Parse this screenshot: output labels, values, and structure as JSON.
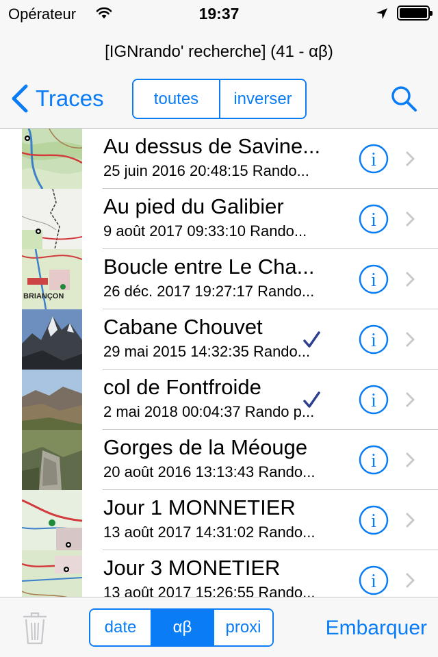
{
  "status_bar": {
    "carrier": "Opérateur",
    "time": "19:37",
    "battery_level_percent": 100
  },
  "nav": {
    "prompt": "[IGNrando' recherche] (41 - αβ)",
    "back_label": "Traces",
    "filter_segments": [
      "toutes",
      "inverser"
    ],
    "search_icon": "search-icon"
  },
  "list": {
    "rows": [
      {
        "title": "Au dessus de Savine...",
        "subtitle": "25 juin 2016 20:48:15 Rando...",
        "thumb": "map-topo",
        "checked": false
      },
      {
        "title": "Au pied du  Galibier",
        "subtitle": "9 août 2017 09:33:10 Rando...",
        "thumb": "map-sketch",
        "checked": false
      },
      {
        "title": "Boucle entre Le Cha...",
        "subtitle": "26 déc. 2017 19:27:17 Rando...",
        "thumb": "map-town",
        "checked": false
      },
      {
        "title": "Cabane Chouvet",
        "subtitle": "29 mai 2015 14:32:35 Rando...",
        "thumb": "photo-peak",
        "checked": true
      },
      {
        "title": "col de Fontfroide",
        "subtitle": "2 mai 2018 00:04:37 Rando p...",
        "thumb": "photo-valley",
        "checked": true
      },
      {
        "title": "Gorges de la Méouge",
        "subtitle": "20 août 2016 13:13:43 Rando...",
        "thumb": "photo-gorge",
        "checked": false
      },
      {
        "title": "Jour 1 MONNETIER",
        "subtitle": "13 août 2017 14:31:02 Rando...",
        "thumb": "map-road",
        "checked": false
      },
      {
        "title": "Jour 3 MONETIER",
        "subtitle": "13 août 2017 15:26:55 Rando...",
        "thumb": "map-grave",
        "checked": false
      }
    ]
  },
  "toolbar": {
    "sort_segments": [
      "date",
      "αβ",
      "proxi"
    ],
    "sort_selected": "αβ",
    "embark_label": "Embarquer"
  },
  "colors": {
    "accent": "#0a7cf6",
    "check": "#2e3f8f",
    "bar_background": "#f7f7f7",
    "separator": "#c8c7cc"
  }
}
